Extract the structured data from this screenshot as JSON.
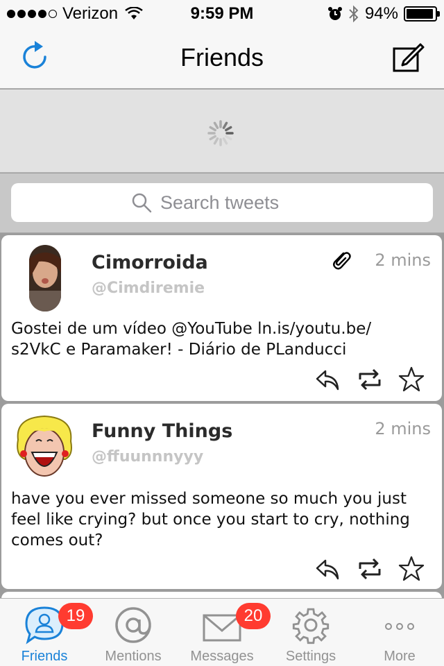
{
  "status_bar": {
    "carrier": "Verizon",
    "time": "9:59 PM",
    "battery_percent": "94%",
    "battery_level": 0.94
  },
  "nav": {
    "title": "Friends"
  },
  "search": {
    "placeholder": "Search tweets"
  },
  "tweets": [
    {
      "author": "Cimorroida",
      "handle": "@Cimdiremie",
      "time": "2 mins",
      "text_line1": "Gostei de um vídeo @YouTube ln.is/youtu.be/",
      "text_line2": "s2VkC e Paramaker! - Diário de PLanducci",
      "has_attachment": true
    },
    {
      "author": "Funny Things",
      "handle": "@ffuunnnyyy",
      "time": "2 mins",
      "text_line1": "have you ever missed someone so much you just",
      "text_line2": "feel like crying? but once you start to cry, nothing",
      "text_line3": "comes out?"
    }
  ],
  "tabs": [
    {
      "label": "Friends",
      "badge": "19",
      "icon": "person-bubble-icon",
      "active": true
    },
    {
      "label": "Mentions",
      "icon": "at-icon"
    },
    {
      "label": "Messages",
      "badge": "20",
      "icon": "envelope-icon"
    },
    {
      "label": "Settings",
      "icon": "gear-icon"
    },
    {
      "label": "More",
      "icon": "more-dots-icon"
    }
  ],
  "colors": {
    "accent": "#1a82d8",
    "badge": "#ff3b30",
    "muted": "#929292"
  }
}
